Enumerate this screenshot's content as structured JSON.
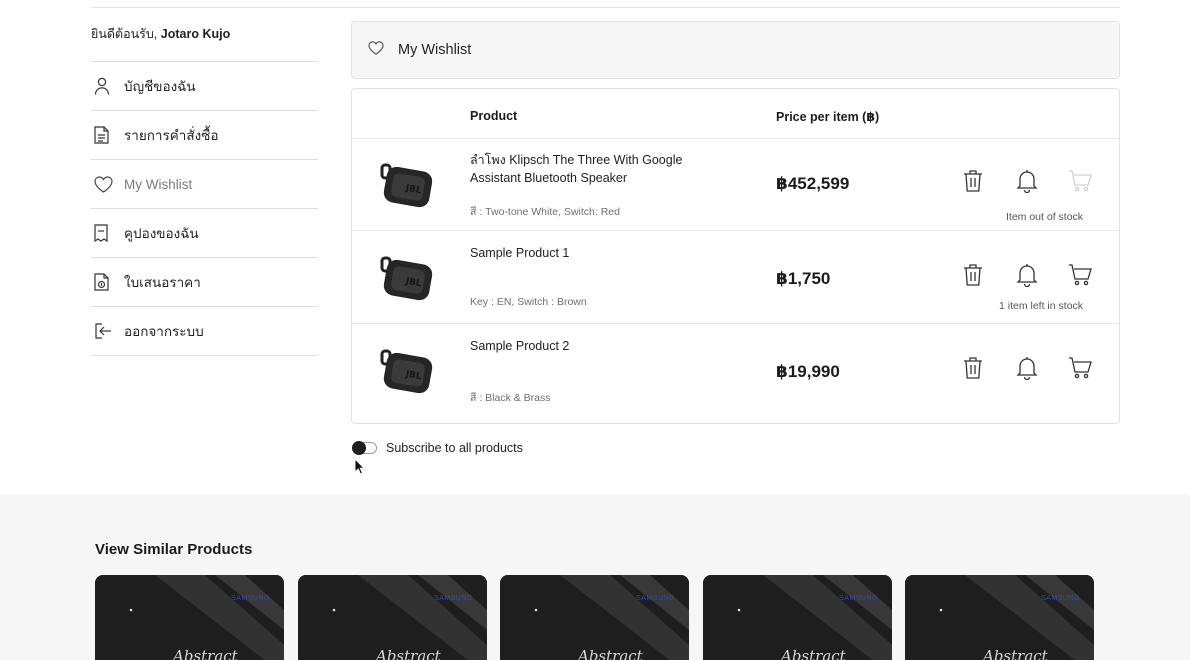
{
  "sidebar": {
    "welcome_prefix": "ยินดีต้อนรับ,",
    "user_name": "Jotaro Kujo",
    "items": [
      {
        "label": "บัญชีของฉัน",
        "icon": "user-icon"
      },
      {
        "label": "รายการคำสั่งซื้อ",
        "icon": "document-icon"
      },
      {
        "label": "My Wishlist",
        "icon": "heart-icon"
      },
      {
        "label": "คูปองของฉัน",
        "icon": "coupon-icon"
      },
      {
        "label": "ใบเสนอราคา",
        "icon": "quote-icon"
      },
      {
        "label": "ออกจากระบบ",
        "icon": "logout-icon"
      }
    ]
  },
  "wishlist": {
    "title": "My Wishlist",
    "col_product": "Product",
    "col_price": "Price per item (฿)",
    "items": [
      {
        "name": "ลำโพง Klipsch The Three With Google Assistant Bluetooth Speaker",
        "variant": "สี : Two-tone White, Switch: Red",
        "price": "฿452,599",
        "stock": "Item out of stock"
      },
      {
        "name": "Sample Product 1",
        "variant": "Key : EN, Switch : Brown",
        "price": "฿1,750",
        "stock": "1 item left in stock"
      },
      {
        "name": "Sample Product 2",
        "variant": "สี : Black & Brass",
        "price": "฿19,990",
        "stock": ""
      }
    ]
  },
  "subscribe": {
    "label": "Subscribe to all products"
  },
  "similar": {
    "title": "View Similar Products",
    "brand": "SAMSUNG",
    "script": "Abstract"
  },
  "colors": {
    "accent": "#1c1c1c",
    "disabled_cart": "#d0d0d0",
    "brand_blue": "#2d48c9"
  }
}
